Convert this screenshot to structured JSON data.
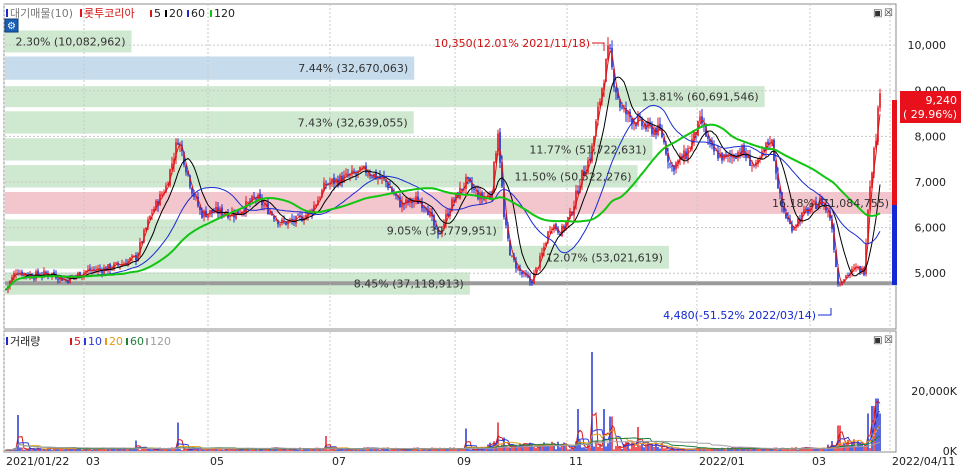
{
  "colors": {
    "up": "#e8101a",
    "down": "#1428d4",
    "ma5": "#d41a1a",
    "ma20": "#000000",
    "ma60": "#1a2bd4",
    "ma120": "#11c511",
    "vol_ma5": "#d41a1a",
    "vol_ma10": "#2a3bd8",
    "vol_ma20": "#e59a1a",
    "vol_ma60": "#1f7f3a",
    "vol_ma120": "#a0a0a0",
    "band_green": "#cfe8d0",
    "band_blue": "#c6dcec",
    "band_red": "#f2c6cc",
    "band_gray": "#9a9a9a",
    "grid": "#c8c8c8",
    "current_price_bg": "#e8101a"
  },
  "top_icon": "gear-icon",
  "price_legend": {
    "prefix": "대기매물(10)",
    "name": "롯투코리아",
    "ma": [
      "5",
      "20",
      "60",
      "120"
    ]
  },
  "volume_legend": {
    "name": "거래량",
    "ma": [
      "5",
      "10",
      "20",
      "60",
      "120"
    ]
  },
  "window_buttons": {
    "price_max": "▣",
    "price_close": "☒",
    "vol_max": "▣",
    "vol_close": "☒"
  },
  "annotations": {
    "high": "10,350(12.01% 2021/11/18)",
    "low": "4,480(-51.52% 2022/03/14)",
    "current_price": "9,240",
    "current_change": "( 29.96%)"
  },
  "chart_data": [
    {
      "type": "candlestick",
      "title": "롯투코리아",
      "x_dates": [
        "2021/01/22",
        "2022/04/11"
      ],
      "x_tick_labels": [
        "2021/01/22",
        "03",
        "05",
        "07",
        "09",
        "11",
        "2022/01",
        "03",
        "2022/04/11"
      ],
      "y_tick_labels": [
        "5,000",
        "6,000",
        "7,000",
        "8,000",
        "9,000",
        "10,000"
      ],
      "y_ticks": [
        5000,
        6000,
        7000,
        8000,
        9000,
        10000
      ],
      "ylim": [
        3800,
        10550
      ],
      "high": {
        "price": 10350,
        "change_pct": 12.01,
        "date": "2021/11/18"
      },
      "low": {
        "price": 4480,
        "change_pct": -51.52,
        "date": "2022/03/14"
      },
      "last": {
        "price": 9240,
        "change_pct": 29.96
      },
      "moving_averages": [
        "5",
        "20",
        "60",
        "120"
      ],
      "price_path": [
        [
          0,
          4650
        ],
        [
          10,
          5050
        ],
        [
          25,
          4950
        ],
        [
          45,
          5000
        ],
        [
          60,
          4850
        ],
        [
          80,
          5050
        ],
        [
          100,
          5100
        ],
        [
          115,
          5200
        ],
        [
          130,
          5350
        ],
        [
          145,
          6300
        ],
        [
          160,
          6900
        ],
        [
          172,
          7950
        ],
        [
          178,
          7500
        ],
        [
          185,
          6900
        ],
        [
          195,
          6300
        ],
        [
          210,
          6350
        ],
        [
          230,
          6300
        ],
        [
          250,
          6650
        ],
        [
          262,
          6400
        ],
        [
          275,
          6100
        ],
        [
          290,
          6150
        ],
        [
          305,
          6350
        ],
        [
          320,
          6950
        ],
        [
          340,
          7100
        ],
        [
          360,
          7250
        ],
        [
          380,
          7000
        ],
        [
          395,
          6500
        ],
        [
          410,
          6600
        ],
        [
          420,
          6500
        ],
        [
          432,
          5800
        ],
        [
          445,
          6500
        ],
        [
          460,
          7000
        ],
        [
          475,
          6650
        ],
        [
          485,
          6700
        ],
        [
          492,
          8150
        ],
        [
          498,
          6200
        ],
        [
          505,
          5350
        ],
        [
          515,
          5000
        ],
        [
          525,
          4800
        ],
        [
          535,
          5350
        ],
        [
          545,
          6100
        ],
        [
          555,
          5900
        ],
        [
          565,
          6300
        ],
        [
          575,
          7100
        ],
        [
          585,
          7600
        ],
        [
          595,
          8950
        ],
        [
          603,
          9950
        ],
        [
          607,
          9300
        ],
        [
          615,
          8600
        ],
        [
          625,
          8400
        ],
        [
          640,
          8200
        ],
        [
          655,
          8100
        ],
        [
          665,
          7300
        ],
        [
          680,
          7600
        ],
        [
          695,
          8350
        ],
        [
          705,
          7700
        ],
        [
          720,
          7500
        ],
        [
          735,
          7700
        ],
        [
          750,
          7300
        ],
        [
          765,
          8000
        ],
        [
          775,
          6500
        ],
        [
          785,
          6000
        ],
        [
          800,
          6350
        ],
        [
          815,
          6600
        ],
        [
          825,
          6200
        ],
        [
          832,
          4780
        ],
        [
          840,
          4950
        ],
        [
          850,
          5100
        ],
        [
          858,
          5050
        ],
        [
          863,
          6800
        ],
        [
          867,
          7500
        ],
        [
          871,
          8200
        ],
        [
          874,
          9100
        ]
      ],
      "volume_profile": {
        "bands": [
          {
            "label": "2.30% (10,082,962)",
            "price_from": 9840,
            "price_to": 10320,
            "pct": 2.3,
            "volume": 10082962,
            "highlight": "none"
          },
          {
            "label": "7.44% (32,670,063)",
            "price_from": 9240,
            "price_to": 9750,
            "pct": 7.44,
            "volume": 32670063,
            "highlight": "blue"
          },
          {
            "label": "13.81% (60,691,546)",
            "price_from": 8640,
            "price_to": 9100,
            "pct": 13.81,
            "volume": 60691546,
            "highlight": "none"
          },
          {
            "label": "7.43% (32,639,055)",
            "price_from": 8060,
            "price_to": 8550,
            "pct": 7.43,
            "volume": 32639055,
            "highlight": "none"
          },
          {
            "label": "11.77% (51,722,631)",
            "price_from": 7470,
            "price_to": 7960,
            "pct": 11.77,
            "volume": 51722631,
            "highlight": "none"
          },
          {
            "label": "11.50% (50,522,276)",
            "price_from": 6880,
            "price_to": 7370,
            "pct": 11.5,
            "volume": 50522276,
            "highlight": "none"
          },
          {
            "label": "16.18% (71,084,755)",
            "price_from": 6300,
            "price_to": 6780,
            "pct": 16.18,
            "volume": 71084755,
            "highlight": "red"
          },
          {
            "label": "9.05% (39,779,951)",
            "price_from": 5700,
            "price_to": 6180,
            "pct": 9.05,
            "volume": 39779951,
            "highlight": "none"
          },
          {
            "label": "12.07% (53,021,619)",
            "price_from": 5100,
            "price_to": 5600,
            "pct": 12.07,
            "volume": 53021619,
            "highlight": "none"
          },
          {
            "label": "8.45% (37,118,913)",
            "price_from": 4530,
            "price_to": 5020,
            "pct": 8.45,
            "volume": 37118913,
            "highlight": "none"
          }
        ],
        "support_line": 4780
      }
    },
    {
      "type": "bar",
      "title": "거래량",
      "y_tick_labels": [
        "0K",
        "20,000K"
      ],
      "y_ticks": [
        0,
        20000
      ],
      "ylim": [
        0,
        33000
      ],
      "unit": "K",
      "moving_averages": [
        "5",
        "10",
        "20",
        "60",
        "120"
      ],
      "spikes": [
        {
          "x": 12,
          "value": 12000
        },
        {
          "x": 130,
          "value": 3500
        },
        {
          "x": 172,
          "value": 9500
        },
        {
          "x": 320,
          "value": 5000
        },
        {
          "x": 460,
          "value": 7500
        },
        {
          "x": 492,
          "value": 9500
        },
        {
          "x": 498,
          "value": 4500
        },
        {
          "x": 572,
          "value": 14000
        },
        {
          "x": 586,
          "value": 33000
        },
        {
          "x": 598,
          "value": 14000
        },
        {
          "x": 605,
          "value": 11500
        },
        {
          "x": 632,
          "value": 8000
        },
        {
          "x": 833,
          "value": 8500
        },
        {
          "x": 862,
          "value": 12500
        },
        {
          "x": 867,
          "value": 15000
        },
        {
          "x": 871,
          "value": 17500
        },
        {
          "x": 874,
          "value": 12500
        }
      ]
    }
  ]
}
